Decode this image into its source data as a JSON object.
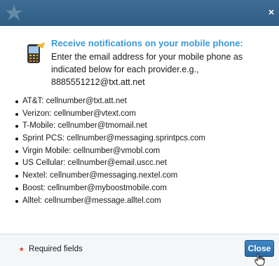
{
  "dialog": {
    "close_glyph": "×",
    "logo_icon": "star-logo-icon"
  },
  "notice": {
    "icon": "phone-icon",
    "title": "Receive notifications on your mobile phone:",
    "body": "Enter the email address for your mobile phone as indicated below for each provider.e.g., 8885551212@txt.att.net"
  },
  "providers": [
    "AT&T: cellnumber@txt.att.net",
    "Verizon: cellnumber@vtext.com",
    "T-Mobile: cellnumber@tmomail.net",
    "Sprint PCS: cellnumber@messaging.sprintpcs.com",
    "Virgin Mobile: cellnumber@vmobl.com",
    "US Cellular: cellnumber@email.uscc.net",
    "Nextel: cellnumber@messaging.nextel.com",
    "Boost: cellnumber@myboostmobile.com",
    "Alltel: cellnumber@message.alltel.com"
  ],
  "footer": {
    "required_marker": "*",
    "required_label": "Required fields",
    "close_label": "Close"
  },
  "colors": {
    "titlebar": "#2f5c83",
    "notice_title": "#3a9ad9",
    "required_star": "#d23a2a",
    "close_button": "#2a6aa6"
  }
}
